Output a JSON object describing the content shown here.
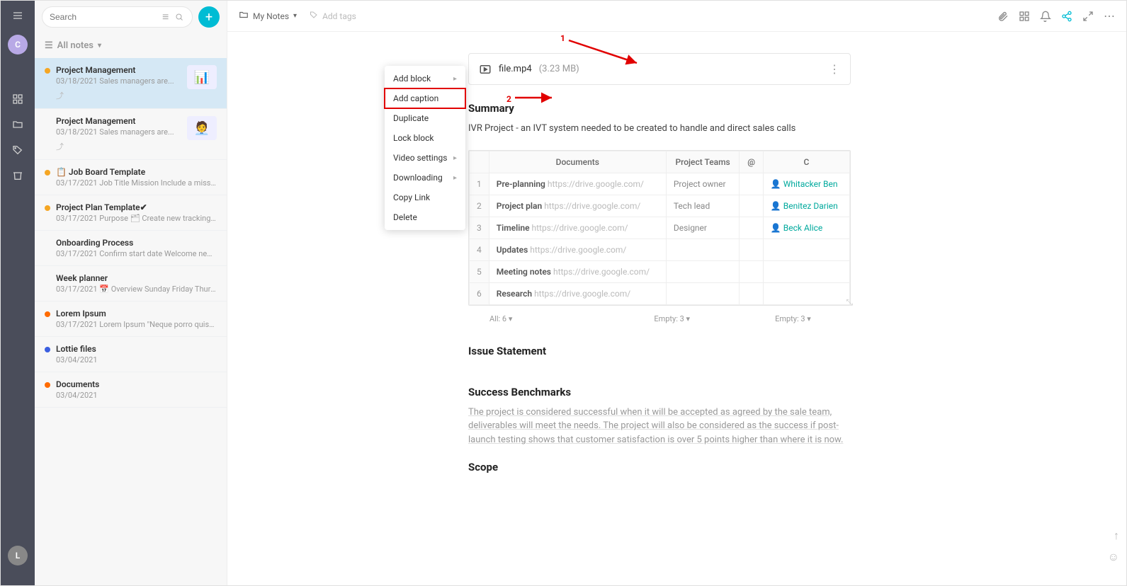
{
  "nav": {
    "avatar_initial": "C",
    "bottom_initial": "L"
  },
  "sidebar": {
    "search_placeholder": "Search",
    "header": "All notes",
    "notes": [
      {
        "dot": "#f5a623",
        "title": "Project Management",
        "date": "03/18/2021",
        "preview": "Sales managers are...",
        "thumb": "📊",
        "selected": true,
        "share": true
      },
      {
        "dot": "",
        "title": "Project Management",
        "date": "03/18/2021",
        "preview": "Sales managers are...",
        "thumb": "🧑‍💼",
        "share": true
      },
      {
        "dot": "#f5a623",
        "title": "📋 Job Board Template",
        "date": "03/17/2021",
        "preview": "Job Title Mission Include a missio..."
      },
      {
        "dot": "#f5a623",
        "title": "Project Plan Template✔",
        "date": "03/17/2021",
        "preview": "Purpose 🗂 Create new tracking s..."
      },
      {
        "dot": "",
        "title": "Onboarding Process",
        "date": "03/17/2021",
        "preview": "Confirm start date Welcome new ..."
      },
      {
        "dot": "",
        "title": "Week planner",
        "date": "03/17/2021",
        "preview": "📅 Overview Sunday Friday Thurs..."
      },
      {
        "dot": "#ff6b00",
        "title": "Lorem Ipsum",
        "date": "03/17/2021",
        "preview": "Lorem Ipsum \"Neque porro quisq..."
      },
      {
        "dot": "#3b5fe0",
        "title": "Lottie files",
        "date": "03/04/2021",
        "preview": ""
      },
      {
        "dot": "#ff6b00",
        "title": "Documents",
        "date": "03/04/2021",
        "preview": ""
      }
    ]
  },
  "topbar": {
    "breadcrumb": "My Notes",
    "add_tags": "Add tags"
  },
  "file": {
    "name": "file.mp4",
    "size": "(3.23 MB)"
  },
  "context_menu": [
    {
      "label": "Add block",
      "sub": true
    },
    {
      "label": "Add caption",
      "highlight": true
    },
    {
      "label": "Duplicate"
    },
    {
      "label": "Lock block"
    },
    {
      "label": "Video settings",
      "sub": true
    },
    {
      "label": "Downloading",
      "sub": true
    },
    {
      "label": "Copy Link"
    },
    {
      "label": "Delete"
    }
  ],
  "doc": {
    "summary_h": "Summary",
    "summary_p": "IVR Project - an IVT system needed to be created to handle and direct sales calls",
    "table": {
      "headers": [
        "Documents",
        "Project Teams",
        "@",
        "C"
      ],
      "rows": [
        {
          "n": "1",
          "doc": "Pre-planning",
          "link": "https://drive.google.com/",
          "team": "Project owner",
          "contact": "Whitacker Ben"
        },
        {
          "n": "2",
          "doc": "Project plan",
          "link": "https://drive.google.com/",
          "team": "Tech lead",
          "contact": "Benitez Darien"
        },
        {
          "n": "3",
          "doc": "Timeline",
          "link": "https://drive.google.com/",
          "team": "Designer",
          "contact": "Beck Alice"
        },
        {
          "n": "4",
          "doc": "Updates",
          "link": "https://drive.google.com/",
          "team": "",
          "contact": ""
        },
        {
          "n": "5",
          "doc": "Meeting notes",
          "link": "https://drive.google.com/",
          "team": "",
          "contact": ""
        },
        {
          "n": "6",
          "doc": "Research",
          "link": "https://drive.google.com/",
          "team": "",
          "contact": ""
        }
      ],
      "footer": {
        "all": "All: 6",
        "empty1": "Empty: 3",
        "empty2": "Empty: 3"
      }
    },
    "issue_h": "Issue Statement",
    "success_h": "Success Benchmarks",
    "success_p": "The project is considered successful when it will be accepted as agreed by the sale team, deliverables will meet the needs. The project will also be considered as the success if post-launch testing shows that customer satisfaction is over 5 points higher than where it is now.",
    "scope_h": "Scope"
  },
  "annotations": {
    "one": "1",
    "two": "2"
  }
}
